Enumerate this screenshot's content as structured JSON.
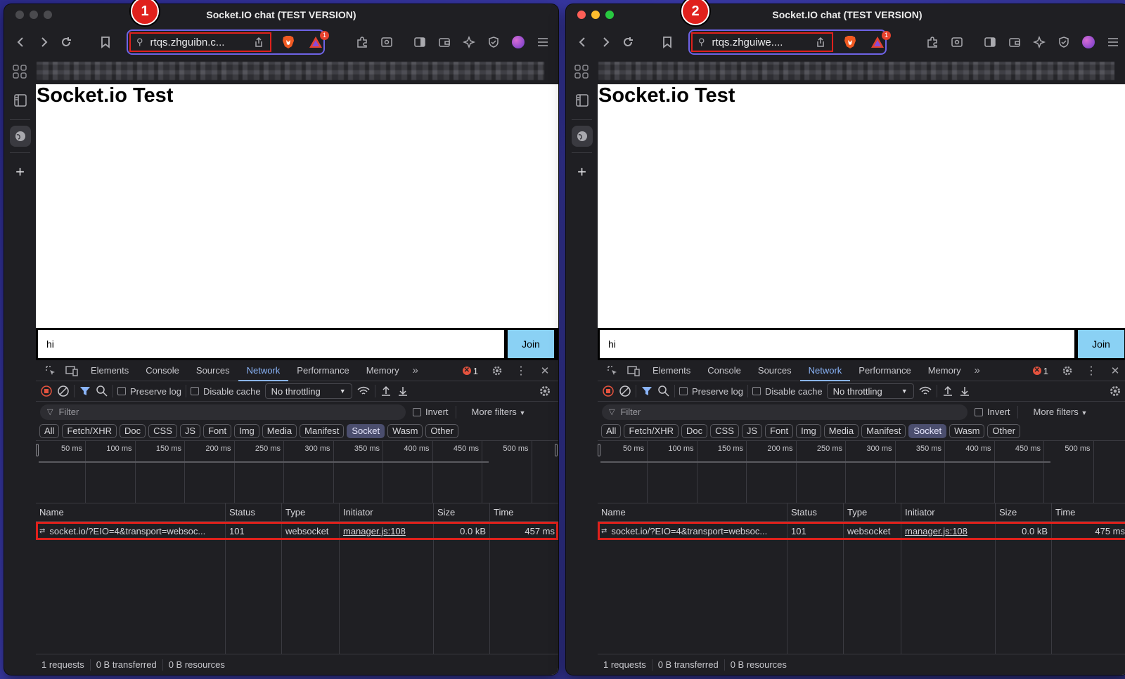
{
  "background_label": "cloudflare",
  "colors": {
    "highlight": "#e0211c",
    "url_focus": "#6e63e6",
    "accent": "#8ab4f8",
    "join_button": "#8ad1f4"
  },
  "windows": [
    {
      "callout": "1",
      "title": "Socket.IO chat (TEST VERSION)",
      "url": "rtqs.zhguibn.c...",
      "rewards_badge": "1",
      "page": {
        "heading": "Socket.io Test",
        "input_value": "hi",
        "join_label": "Join"
      },
      "devtools": {
        "tabs": [
          "Elements",
          "Console",
          "Sources",
          "Network",
          "Performance",
          "Memory"
        ],
        "active_tab": "Network",
        "error_count": "1",
        "preserve_log": "Preserve log",
        "disable_cache": "Disable cache",
        "throttling": "No throttling",
        "filter_placeholder": "Filter",
        "invert": "Invert",
        "more_filters": "More filters",
        "chips": [
          "All",
          "Fetch/XHR",
          "Doc",
          "CSS",
          "JS",
          "Font",
          "Img",
          "Media",
          "Manifest",
          "Socket",
          "Wasm",
          "Other"
        ],
        "active_chip": "Socket",
        "timeline_labels": [
          "50 ms",
          "100 ms",
          "150 ms",
          "200 ms",
          "250 ms",
          "300 ms",
          "350 ms",
          "400 ms",
          "450 ms",
          "500 ms"
        ],
        "columns": {
          "name": "Name",
          "status": "Status",
          "type": "Type",
          "initiator": "Initiator",
          "size": "Size",
          "time": "Time"
        },
        "rows": [
          {
            "name": "socket.io/?EIO=4&transport=websoc...",
            "status": "101",
            "type": "websocket",
            "initiator": "manager.js:108",
            "size": "0.0 kB",
            "time": "457 ms"
          }
        ],
        "status": {
          "requests": "1 requests",
          "transferred": "0 B transferred",
          "resources": "0 B resources"
        }
      }
    },
    {
      "callout": "2",
      "title": "Socket.IO chat (TEST VERSION)",
      "url": "rtqs.zhguiwe....",
      "rewards_badge": "1",
      "page": {
        "heading": "Socket.io Test",
        "input_value": "hi",
        "join_label": "Join"
      },
      "devtools": {
        "tabs": [
          "Elements",
          "Console",
          "Sources",
          "Network",
          "Performance",
          "Memory"
        ],
        "active_tab": "Network",
        "error_count": "1",
        "preserve_log": "Preserve log",
        "disable_cache": "Disable cache",
        "throttling": "No throttling",
        "filter_placeholder": "Filter",
        "invert": "Invert",
        "more_filters": "More filters",
        "chips": [
          "All",
          "Fetch/XHR",
          "Doc",
          "CSS",
          "JS",
          "Font",
          "Img",
          "Media",
          "Manifest",
          "Socket",
          "Wasm",
          "Other"
        ],
        "active_chip": "Socket",
        "timeline_labels": [
          "50 ms",
          "100 ms",
          "150 ms",
          "200 ms",
          "250 ms",
          "300 ms",
          "350 ms",
          "400 ms",
          "450 ms",
          "500 ms"
        ],
        "columns": {
          "name": "Name",
          "status": "Status",
          "type": "Type",
          "initiator": "Initiator",
          "size": "Size",
          "time": "Time"
        },
        "rows": [
          {
            "name": "socket.io/?EIO=4&transport=websoc...",
            "status": "101",
            "type": "websocket",
            "initiator": "manager.js:108",
            "size": "0.0 kB",
            "time": "475 ms"
          }
        ],
        "status": {
          "requests": "1 requests",
          "transferred": "0 B transferred",
          "resources": "0 B resources"
        }
      }
    }
  ]
}
